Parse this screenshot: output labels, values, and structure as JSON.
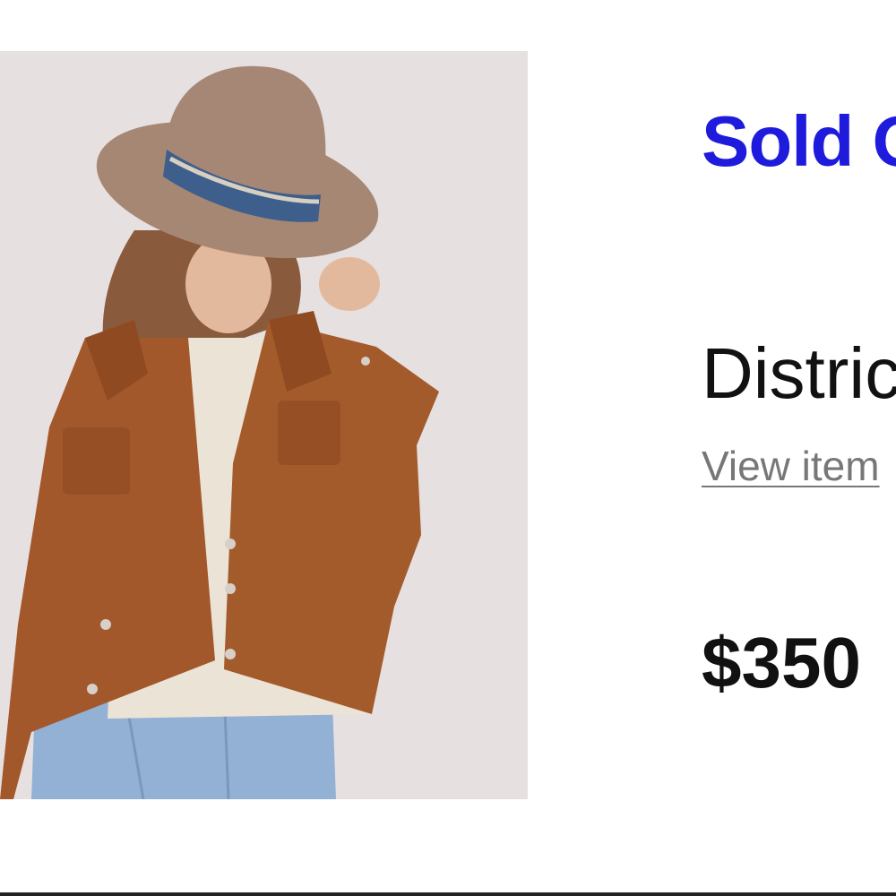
{
  "listing": {
    "status": "Sold O",
    "title": "Distric",
    "view_link": "View item",
    "price": "$350"
  },
  "colors": {
    "status": "#1f1bdc",
    "link": "#777777",
    "text": "#111111"
  }
}
